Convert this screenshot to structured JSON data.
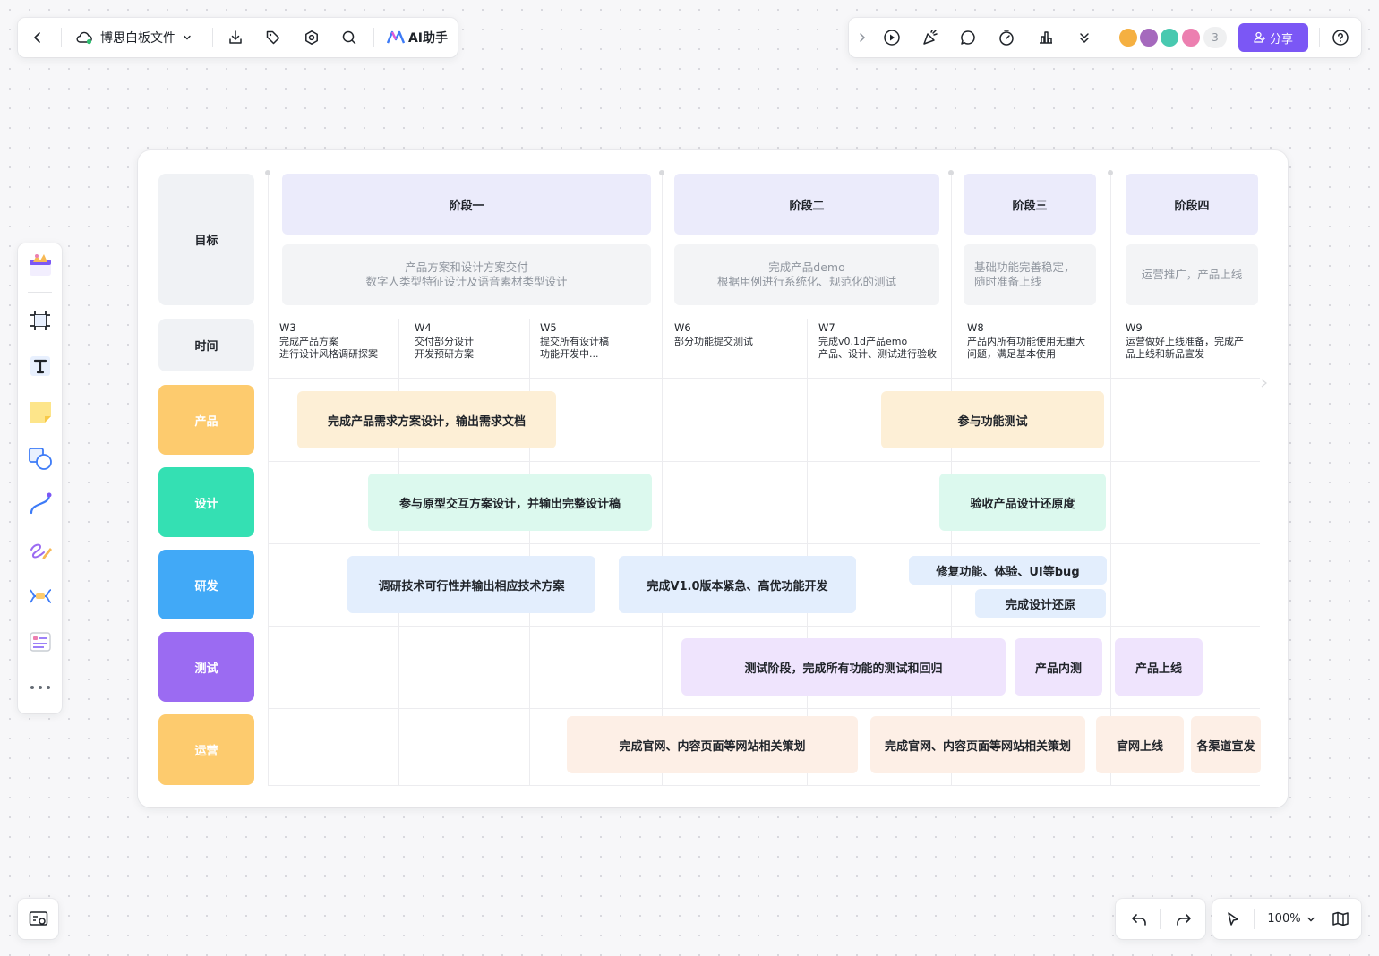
{
  "toolbar_left": {
    "back_icon": "chevron-left-icon",
    "cloud_icon": "cloud-icon",
    "doc_title": "博思白板文件",
    "ai_label": "AI助手"
  },
  "toolbar_right": {
    "avatar_more_count": "3",
    "share_label": "分享"
  },
  "bottom": {
    "zoom": "100%"
  },
  "colors": {
    "accent": "#7b57f5",
    "product": "#fdcb6e",
    "design": "#34e0b3",
    "dev": "#41a9f7",
    "test": "#9b6bf2",
    "ops": "#fdcb6e"
  },
  "board": {
    "row_labels": {
      "goal": "目标",
      "time": "时间",
      "product": "产品",
      "design": "设计",
      "dev": "研发",
      "test": "测试",
      "ops": "运营"
    },
    "phases": [
      "阶段一",
      "阶段二",
      "阶段三",
      "阶段四"
    ],
    "goals": [
      "产品方案和设计方案交付\n数字人类型特征设计及语音素材类型设计",
      "完成产品demo\n根据用例进行系统化、规范化的测试",
      "基础功能完善稳定，\n随时准备上线",
      "运营推广，产品上线"
    ],
    "weeks": [
      {
        "w": "W3",
        "desc": "完成产品方案\n进行设计风格调研探案"
      },
      {
        "w": "W4",
        "desc": "交付部分设计\n开发预研方案"
      },
      {
        "w": "W5",
        "desc": "提交所有设计稿\n功能开发中..."
      },
      {
        "w": "W6",
        "desc": "部分功能提交测试"
      },
      {
        "w": "W7",
        "desc": "完成v0.1d产品emo\n产品、设计、测试进行验收"
      },
      {
        "w": "W8",
        "desc": "产品内所有功能使用无重大\n问题，满足基本使用"
      },
      {
        "w": "W9",
        "desc": "运营做好上线准备，完成产\n品上线和新品宣发"
      }
    ],
    "tasks": {
      "product": [
        "完成产品需求方案设计，输出需求文档",
        "参与功能测试"
      ],
      "design": [
        "参与原型交互方案设计，并输出完整设计稿",
        "验收产品设计还原度"
      ],
      "dev": [
        "调研技术可行性并输出相应技术方案",
        "完成V1.0版本紧急、高优功能开发",
        "修复功能、体验、UI等bug",
        "完成设计还原"
      ],
      "test": [
        "测试阶段，完成所有功能的测试和回归",
        "产品内测",
        "产品上线"
      ],
      "ops": [
        "完成官网、内容页面等网站相关策划",
        "完成官网、内容页面等网站相关策划",
        "官网上线",
        "各渠道宣发"
      ]
    }
  }
}
